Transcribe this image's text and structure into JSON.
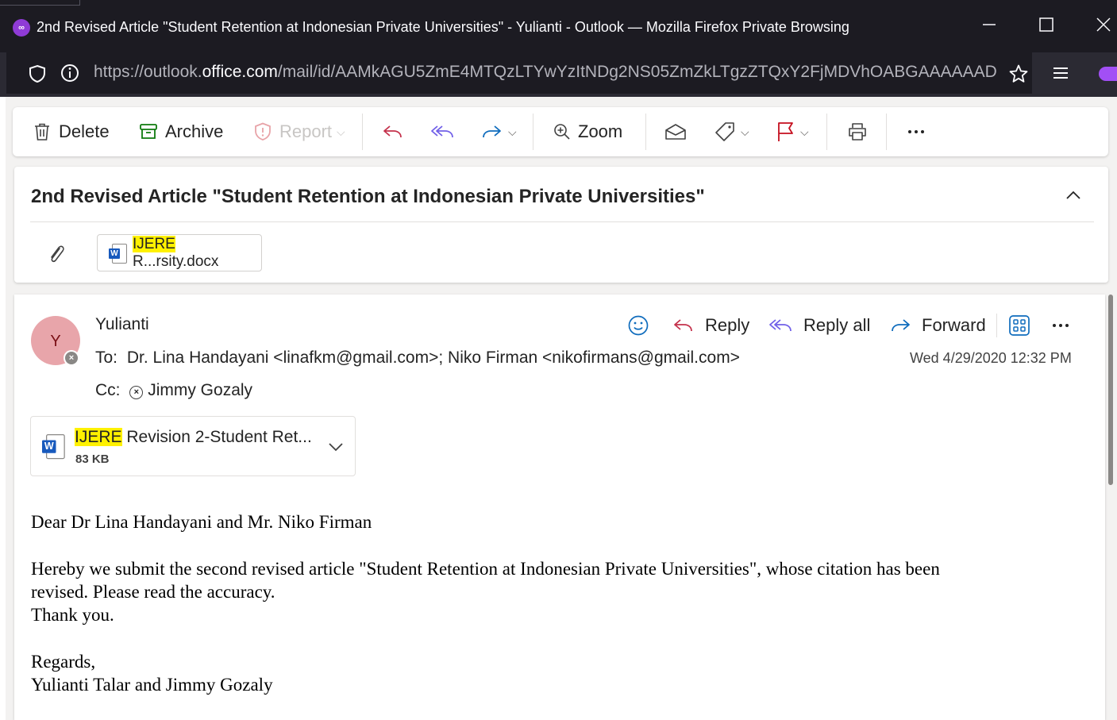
{
  "window": {
    "app_icon": "private-browsing-mask-icon",
    "title": "2nd Revised Article \"Student Retention at Indonesian Private Universities\" - Yulianti - Outlook — Mozilla Firefox Private Browsing"
  },
  "urlbar": {
    "url_prefix": "https://outlook.",
    "url_domain": "office.com",
    "url_path": "/mail/id/AAMkAGU5ZmE4MTQzLTYwYzItNDg2NS05ZmZkLTgzZTQxY2FjMDVhOABGAAAAAAD"
  },
  "toolbar": {
    "delete_label": "Delete",
    "archive_label": "Archive",
    "report_label": "Report",
    "zoom_label": "Zoom"
  },
  "subject": {
    "text": "2nd Revised Article \"Student Retention at Indonesian Private Universities\"",
    "attachment_highlight": "IJERE",
    "attachment_rest": " R...rsity.docx"
  },
  "message": {
    "avatar_initial": "Y",
    "sender": "Yulianti",
    "to_label": "To:",
    "to_recipients": "Dr. Lina Handayani <linafkm@gmail.com>;   Niko Firman <nikofirmans@gmail.com>",
    "cc_label": "Cc:",
    "cc_recipient": "Jimmy Gozaly",
    "date": "Wed 4/29/2020 12:32 PM",
    "actions": {
      "reply": "Reply",
      "reply_all": "Reply all",
      "forward": "Forward"
    },
    "attachment": {
      "highlight": "IJERE",
      "name_rest": " Revision 2-Student Ret...",
      "size": "83 KB"
    },
    "body": {
      "greeting": "Dear Dr Lina Handayani and Mr. Niko Firman",
      "line1": "Hereby we submit the second revised article \"Student Retention at Indonesian Private Universities\", whose citation has been",
      "line2": "revised. Please read the accuracy.",
      "line3": "Thank you.",
      "closing": "Regards,",
      "signature": "Yulianti Talar and Jimmy Gozaly"
    }
  },
  "colors": {
    "titlebar": "#1c1b22",
    "urlbar": "#2b2a33",
    "highlight": "#fff100",
    "accent_blue": "#0f6cbd",
    "flag_red": "#c50f1f",
    "avatar_bg": "#e8a5aa"
  }
}
